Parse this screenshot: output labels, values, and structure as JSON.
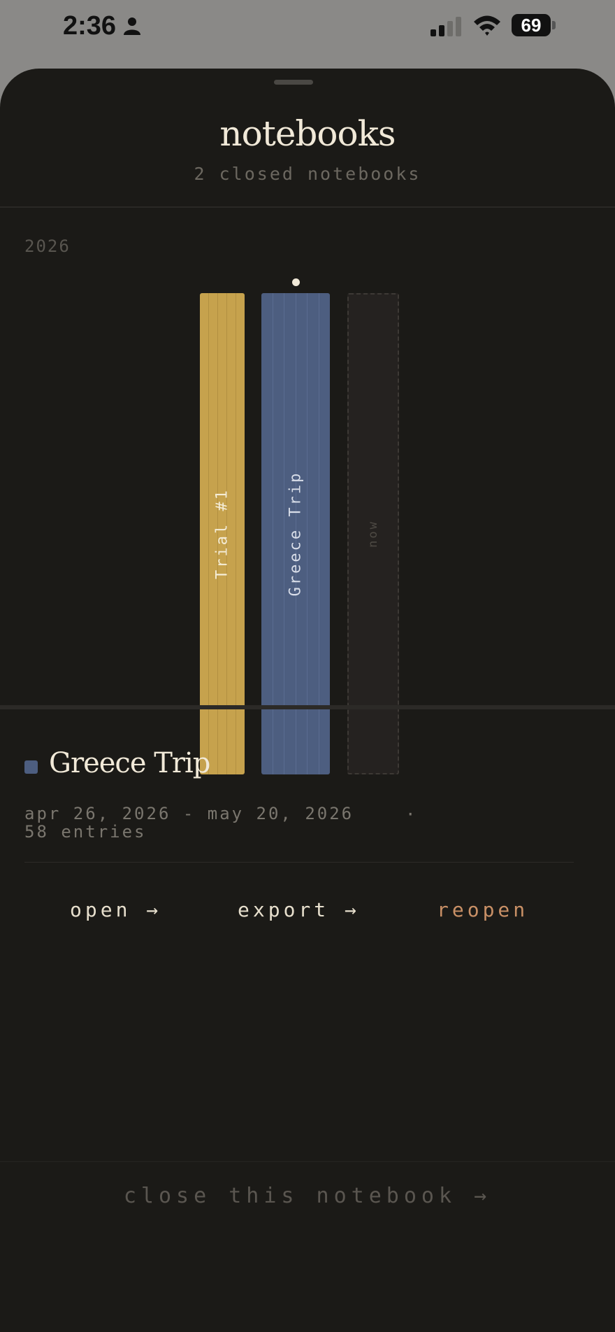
{
  "status_bar": {
    "time": "2:36",
    "battery": "69",
    "icons": [
      "person-icon",
      "signal-icon",
      "wifi-icon",
      "battery-icon"
    ]
  },
  "sheet": {
    "title": "notebooks",
    "subtitle": "2 closed notebooks"
  },
  "shelf": {
    "year": "2026",
    "books": [
      {
        "label": "Trial #1",
        "color": "#c6a24d"
      },
      {
        "label": "Greece Trip",
        "color": "#4d5e80",
        "selected": true
      },
      {
        "label": "now",
        "color": "#252220"
      }
    ]
  },
  "detail": {
    "title": "Greece Trip",
    "swatch_color": "#4d5e80",
    "date_range": "apr 26, 2026 - may 20, 2026",
    "separator": "·",
    "entries": "58 entries"
  },
  "actions": {
    "open": "open →",
    "export": "export →",
    "reopen": "reopen"
  },
  "footer": {
    "close": "close this notebook →"
  },
  "colors": {
    "background": "#1b1a17",
    "text": "#f1e9d8",
    "accent": "#c99066"
  }
}
